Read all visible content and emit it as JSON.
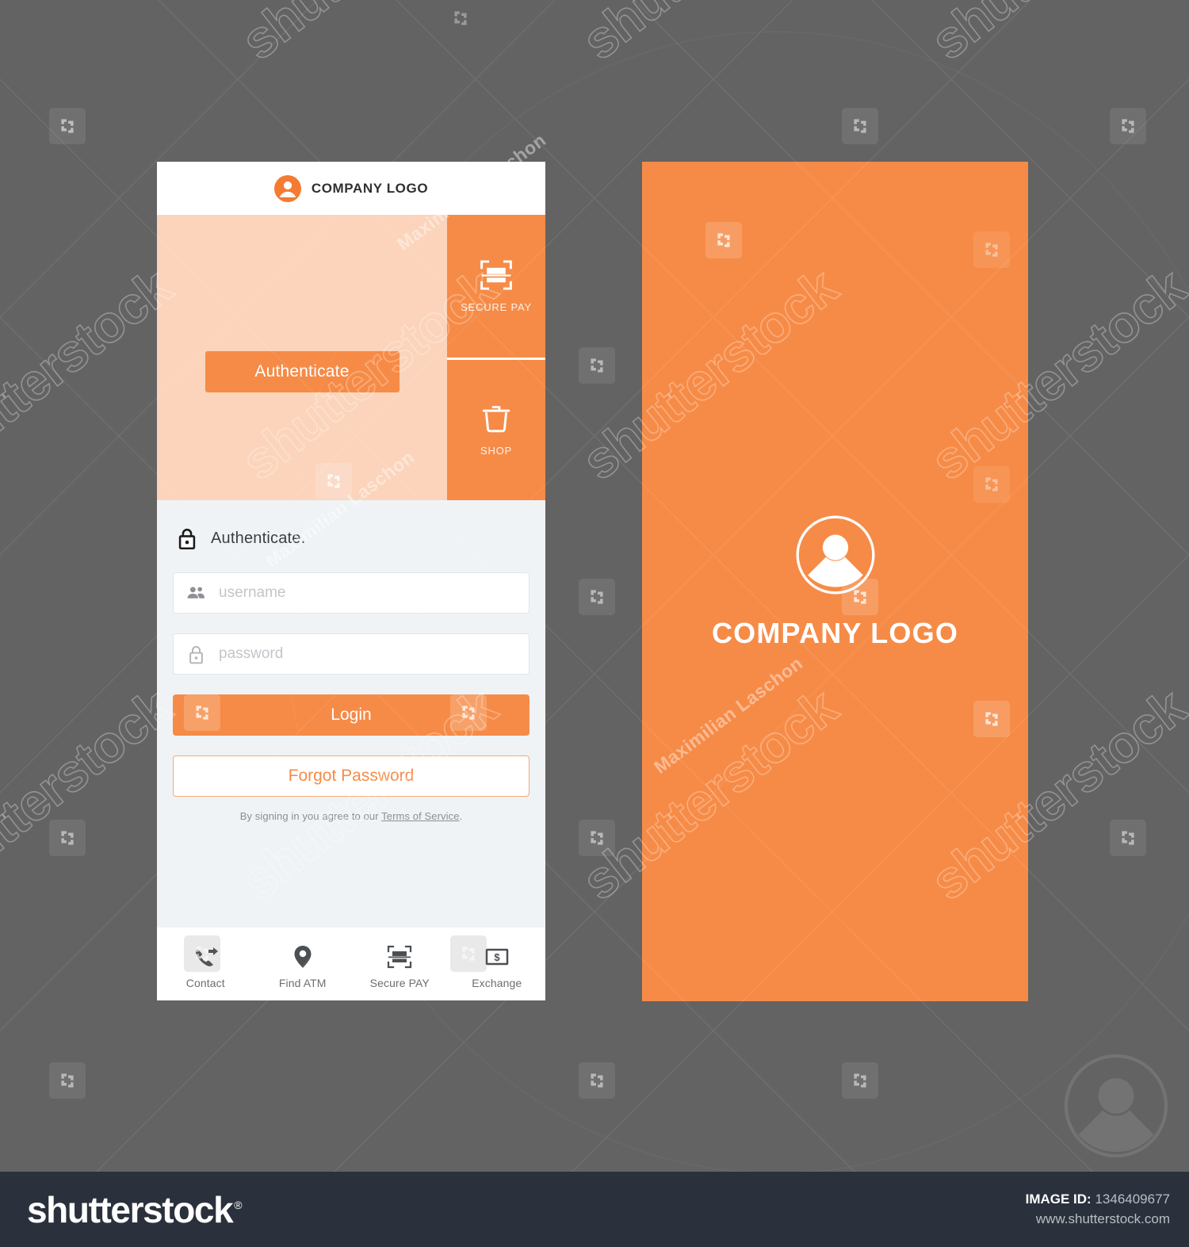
{
  "canvas": {
    "background_color": "#636363",
    "accent_color": "#f68b47",
    "hero_tint_color": "#fbd4bb",
    "form_background_color": "#eff3f6"
  },
  "watermark": {
    "brand_text": "shutterstock",
    "author_text": "Maximilian Laschon",
    "logo_icon": "shutterstock-mark-icon",
    "avatar_icon": "avatar-icon"
  },
  "phone": {
    "topbar": {
      "logo_icon": "avatar-circle-icon",
      "logo_text": "COMPANY LOGO"
    },
    "hero": {
      "authenticate_label": "Authenticate"
    },
    "side_tiles": [
      {
        "icon": "scan-pay-icon",
        "label": "SECURE PAY"
      },
      {
        "icon": "shopping-basket-icon",
        "label": "SHOP"
      }
    ],
    "form": {
      "lock_icon": "lock-icon",
      "heading": "Authenticate.",
      "username": {
        "icon": "users-icon",
        "placeholder": "username",
        "value": ""
      },
      "password": {
        "icon": "lock-outline-icon",
        "placeholder": "password",
        "value": ""
      },
      "login_label": "Login",
      "forgot_label": "Forgot Password",
      "terms_prefix": "By signing in you agree to our ",
      "terms_link": "Terms of Service",
      "terms_suffix": "."
    },
    "bottom_nav": [
      {
        "icon": "phone-forward-icon",
        "label": "Contact"
      },
      {
        "icon": "map-pin-icon",
        "label": "Find ATM"
      },
      {
        "icon": "scan-pay-icon",
        "label": "Secure PAY"
      },
      {
        "icon": "banknote-dollar-icon",
        "label": "Exchange"
      }
    ]
  },
  "splash": {
    "logo_icon": "avatar-circle-outline-icon",
    "title": "COMPANY LOGO"
  },
  "footer": {
    "brand": "shutterstock",
    "registered_mark": "®",
    "image_id_label": "IMAGE ID:",
    "image_id_value": "1346409677",
    "website": "www.shutterstock.com"
  }
}
